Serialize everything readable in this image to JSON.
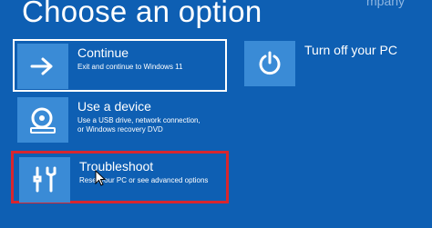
{
  "page": {
    "title": "Choose an option",
    "header_fragment": "mpany"
  },
  "options": [
    {
      "title": "Continue",
      "description": "Exit and continue to Windows 11",
      "icon": "arrow-right-icon"
    },
    {
      "title": "Use a device",
      "description": "Use a USB drive, network connection,\nor Windows recovery DVD",
      "description_line1": "Use a USB drive, network connection,",
      "description_line2": "or Windows recovery DVD",
      "icon": "disc-drive-icon"
    },
    {
      "title": "Troubleshoot",
      "description": "Reset your PC or see advanced options",
      "icon": "tools-icon"
    },
    {
      "title": "Turn off your PC",
      "description": "",
      "icon": "power-icon"
    }
  ],
  "colors": {
    "background": "#0e5fb3",
    "tile": "#3a8bd6",
    "highlight_border": "#d8262e",
    "text": "#ffffff"
  }
}
